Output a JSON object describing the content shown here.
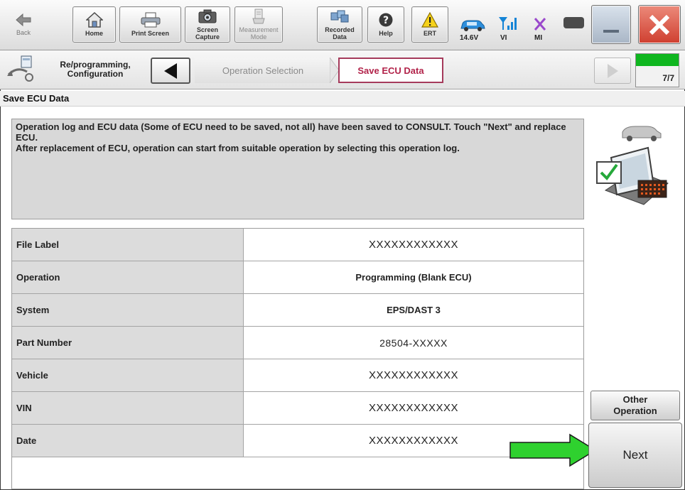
{
  "toolbar": {
    "back": "Back",
    "home": "Home",
    "print_screen": "Print Screen",
    "screen_capture": "Screen Capture",
    "measurement_mode": "Measurement Mode",
    "recorded_data": "Recorded Data",
    "help": "Help",
    "ert": "ERT",
    "voltage": "14.6V",
    "vi": "VI",
    "mi": "MI"
  },
  "nav": {
    "mode_title": "Re/programming, Configuration",
    "crumbs": [
      "Operation Selection",
      "Save ECU Data"
    ],
    "progress_text": "7/7",
    "progress_fraction": 1.0
  },
  "page": {
    "title": "Save ECU Data",
    "message_line1": "Operation log and ECU data (Some of ECU need to be saved, not all) have been saved to CONSULT. Touch \"Next\" and replace ECU.",
    "message_line2": "After replacement of ECU, operation can start from suitable operation by selecting this operation log."
  },
  "table": {
    "rows": [
      {
        "label": "File Label",
        "value": "XXXXXXXXXXXX"
      },
      {
        "label": "Operation",
        "value": "Programming (Blank ECU)"
      },
      {
        "label": "System",
        "value": "EPS/DAST 3"
      },
      {
        "label": "Part Number",
        "value": "28504-XXXXX"
      },
      {
        "label": "Vehicle",
        "value": "XXXXXXXXXXXX"
      },
      {
        "label": "VIN",
        "value": "XXXXXXXXXXXX"
      },
      {
        "label": "Date",
        "value": "XXXXXXXXXXXX"
      }
    ]
  },
  "buttons": {
    "other_operation": "Other Operation",
    "next": "Next"
  },
  "colors": {
    "accent_crumb": "#b2234a",
    "progress": "#0fb61f",
    "arrow": "#2fd12f",
    "close": "#d8483a"
  }
}
